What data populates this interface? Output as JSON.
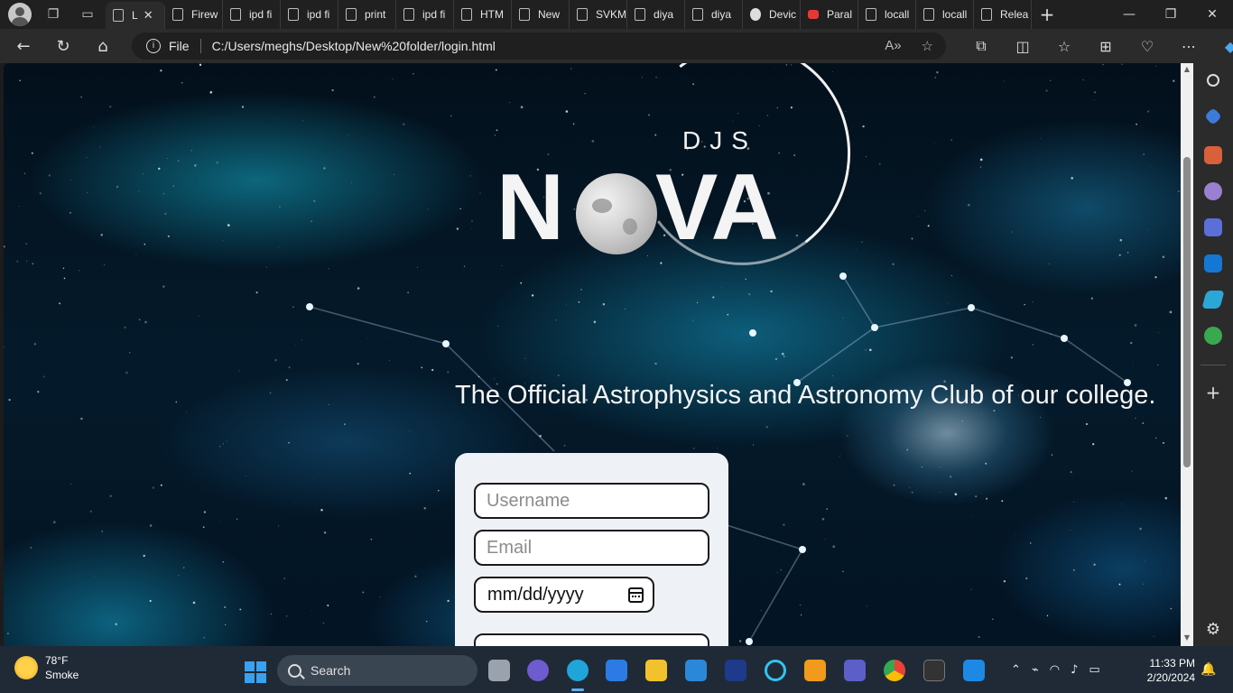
{
  "browser": {
    "tabs": [
      {
        "label": "L",
        "icon": "page-icon",
        "active": true
      },
      {
        "label": "Firew",
        "icon": "page-icon"
      },
      {
        "label": "ipd fi",
        "icon": "page-icon"
      },
      {
        "label": "ipd fi",
        "icon": "page-icon"
      },
      {
        "label": "print",
        "icon": "page-icon"
      },
      {
        "label": "ipd fi",
        "icon": "page-icon"
      },
      {
        "label": "HTM",
        "icon": "page-icon"
      },
      {
        "label": "New",
        "icon": "page-icon"
      },
      {
        "label": "SVKM",
        "icon": "page-icon"
      },
      {
        "label": "diya",
        "icon": "page-icon"
      },
      {
        "label": "diya",
        "icon": "page-icon"
      },
      {
        "label": "Devic",
        "icon": "github-icon"
      },
      {
        "label": "Paral",
        "icon": "youtube-icon"
      },
      {
        "label": "locall",
        "icon": "page-icon"
      },
      {
        "label": "locall",
        "icon": "page-icon"
      },
      {
        "label": "Relea",
        "icon": "page-icon"
      }
    ],
    "address_scheme": "File",
    "address_url": "C:/Users/meghs/Desktop/New%20folder/login.html"
  },
  "page": {
    "logo_top": "DJS",
    "logo_left": "N",
    "logo_right": "VA",
    "tagline": "The Official Astrophysics and Astronomy Club of our college.",
    "username_placeholder": "Username",
    "email_placeholder": "Email",
    "date_value": "mm/dd/yyyy"
  },
  "taskbar": {
    "weather_temp": "78°F",
    "weather_desc": "Smoke",
    "search_label": "Search",
    "time": "11:33 PM",
    "date": "2/20/2024"
  },
  "colors": {
    "accent": "#5ab1ff",
    "form_background": "#eef1f6",
    "page_background": "#041a2a"
  }
}
